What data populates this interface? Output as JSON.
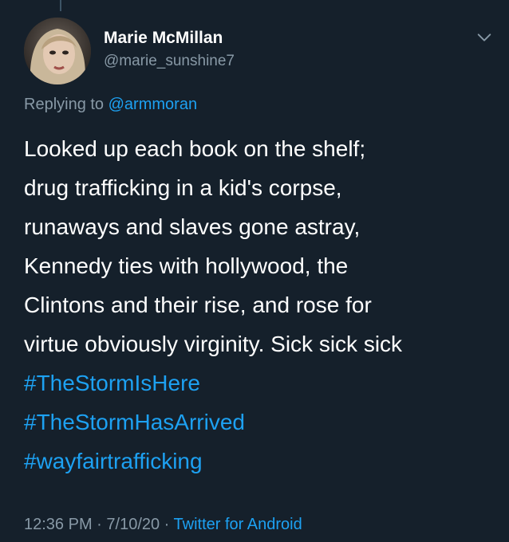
{
  "user": {
    "name": "Marie McMillan",
    "handle": "@marie_sunshine7",
    "avatar_icon": "user-avatar-photo"
  },
  "reply": {
    "prefix": "Replying to ",
    "mention": "@armmoran"
  },
  "tweet": {
    "lines": [
      "Looked up each book on the shelf;",
      "drug trafficking in a kid's corpse,",
      "runaways and slaves gone astray,",
      "Kennedy ties with hollywood, the",
      "Clintons and their rise, and rose for",
      "virtue obviously virginity. Sick sick sick"
    ],
    "hashtags": [
      "#TheStormIsHere",
      "#TheStormHasArrived",
      "#wayfairtrafficking"
    ]
  },
  "meta": {
    "time": "12:36 PM",
    "separator1": " · ",
    "date": "7/10/20",
    "separator2": " · ",
    "source": "Twitter for Android"
  },
  "icons": {
    "menu": "chevron-down-icon"
  },
  "colors": {
    "background": "#15202b",
    "text": "#ffffff",
    "secondary": "#8899a6",
    "accent": "#1da1f2"
  }
}
